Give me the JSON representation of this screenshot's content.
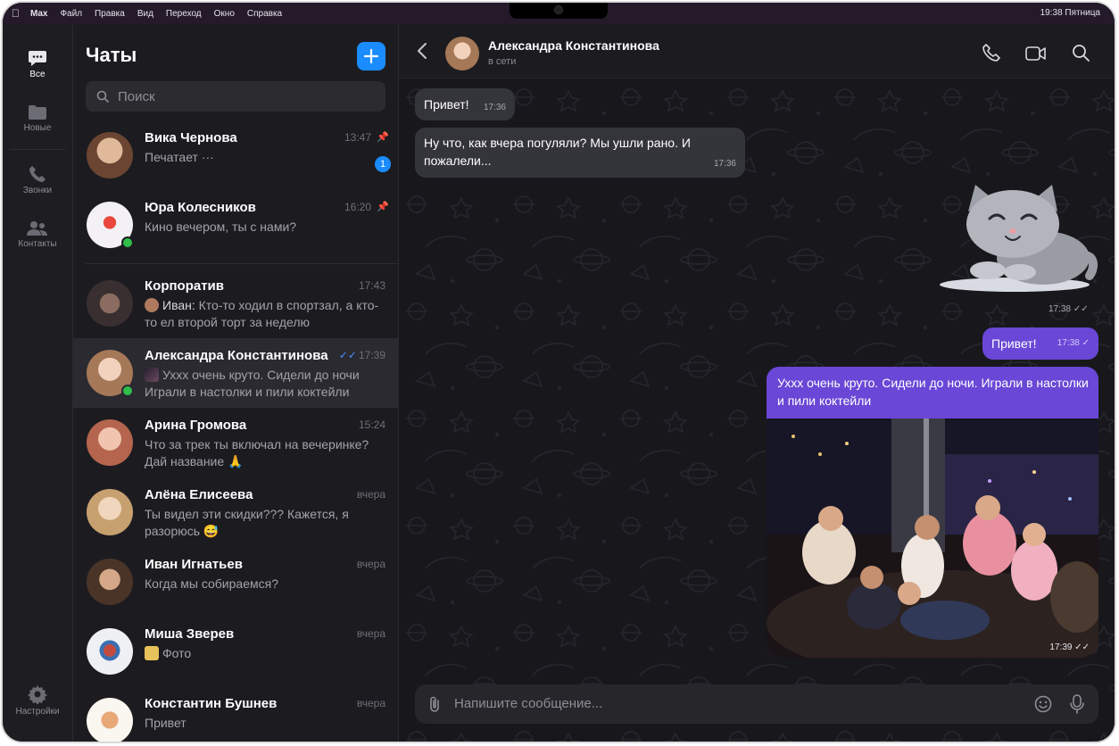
{
  "menubar": {
    "app": "Max",
    "items": [
      "Файл",
      "Правка",
      "Вид",
      "Переход",
      "Окно",
      "Справка"
    ],
    "clock": "19:38 Пятница"
  },
  "rail": {
    "items": [
      {
        "label": "Все",
        "icon": "chat-bubble-icon",
        "active": true
      },
      {
        "label": "Новые",
        "icon": "folder-icon",
        "active": false
      },
      {
        "label": "Звонки",
        "icon": "phone-icon",
        "active": false
      },
      {
        "label": "Контакты",
        "icon": "contacts-icon",
        "active": false
      }
    ],
    "settings_label": "Настройки"
  },
  "chatlist": {
    "title": "Чаты",
    "search_placeholder": "Поиск",
    "chats": [
      {
        "name": "Вика Чернова",
        "time": "13:47",
        "preview": "Печатает ···",
        "pinned": true,
        "unread": "1",
        "online": false,
        "avatar_color": "#b08068"
      },
      {
        "name": "Юра Колесников",
        "time": "16:20",
        "preview": "Кино вечером, ты с нами?",
        "pinned": true,
        "online": true,
        "avatar_color": "#e8e4ea"
      },
      {
        "name": "Корпоратив",
        "time": "17:43",
        "sender": "Иван:",
        "preview": "Кто-то ходил в спортзал, а кто-то ел второй торт за неделю",
        "online": false,
        "avatar_color": "#5a4a48"
      },
      {
        "name": "Александра Константинова",
        "time": "17:39",
        "preview": "Ухxх очень круто. Сидели до ночи Играли в настолки и пили коктейли",
        "online": true,
        "avatar_color": "#c9a48a",
        "active": true
      },
      {
        "name": "Арина Громова",
        "time": "15:24",
        "preview": "Что за трек ты включал на вечеринке? Дай название 🙏",
        "online": false,
        "avatar_color": "#d69a84"
      },
      {
        "name": "Алёна Елисеева",
        "time": "вчера",
        "preview": "Ты видел эти скидки??? Кажется, я разорюсь 😅",
        "online": false,
        "avatar_color": "#d4b896"
      },
      {
        "name": "Иван Игнатьев",
        "time": "вчера",
        "preview": "Когда мы собираемся?",
        "online": false,
        "avatar_color": "#8a6a58"
      },
      {
        "name": "Миша Зверев",
        "time": "вчера",
        "preview": "Фото",
        "online": false,
        "avatar_color": "#e6e6ec"
      },
      {
        "name": "Константин Бушнев",
        "time": "вчера",
        "preview": "Привет",
        "online": false,
        "avatar_color": "#f0e8e0"
      }
    ]
  },
  "conversation": {
    "contact_name": "Александра Константинова",
    "status": "в сети",
    "messages": {
      "m1": {
        "text": "Привет!",
        "time": "17:36"
      },
      "m2": {
        "text": "Ну что, как вчера погуляли? Мы ушли рано. И пожалели...",
        "time": "17:36"
      },
      "sticker_time": "17:38",
      "m3": {
        "text": "Привет!",
        "time": "17:38"
      },
      "m4": {
        "text": "Ухxх очень круто. Сидели до ночи. Играли в настолки и пили коктейли",
        "time": "17:39"
      }
    },
    "composer_placeholder": "Напишите сообщение..."
  },
  "colors": {
    "accent": "#1a8cff",
    "outgoing": "#6a47d6",
    "online": "#2fbf4a"
  }
}
